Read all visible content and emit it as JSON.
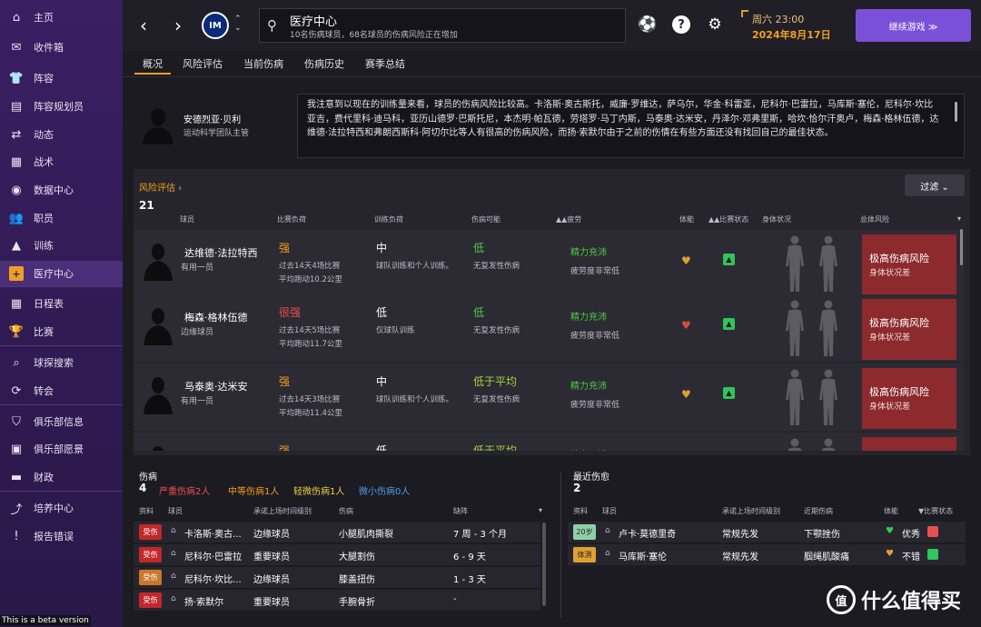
{
  "sidebar": {
    "items": [
      {
        "label": "主页",
        "icon": "home-icon",
        "glyph": "⌂"
      },
      {
        "label": "收件箱",
        "icon": "inbox-icon",
        "glyph": "✉"
      },
      {
        "label": "阵容",
        "icon": "shirt-icon",
        "glyph": "👕"
      },
      {
        "label": "阵容规划员",
        "icon": "clipboard-icon",
        "glyph": "▤"
      },
      {
        "label": "动态",
        "icon": "dynamics-icon",
        "glyph": "⇄"
      },
      {
        "label": "战术",
        "icon": "tactics-icon",
        "glyph": "▦"
      },
      {
        "label": "数据中心",
        "icon": "data-hub-icon",
        "glyph": "◉"
      },
      {
        "label": "职员",
        "icon": "staff-icon",
        "glyph": "👥"
      },
      {
        "label": "训练",
        "icon": "training-icon",
        "glyph": "▲"
      },
      {
        "label": "医疗中心",
        "icon": "medical-icon",
        "glyph": "+"
      },
      {
        "label": "日程表",
        "icon": "calendar-icon",
        "glyph": "▦"
      },
      {
        "label": "比赛",
        "icon": "trophy-icon",
        "glyph": "🏆"
      },
      {
        "label": "球探搜索",
        "icon": "scouting-icon",
        "glyph": "⌕"
      },
      {
        "label": "转会",
        "icon": "transfer-icon",
        "glyph": "⟳"
      },
      {
        "label": "俱乐部信息",
        "icon": "club-info-icon",
        "glyph": "⛉"
      },
      {
        "label": "俱乐部愿景",
        "icon": "club-vision-icon",
        "glyph": "▣"
      },
      {
        "label": "财政",
        "icon": "finance-icon",
        "glyph": "▬"
      },
      {
        "label": "培养中心",
        "icon": "development-icon",
        "glyph": "⤴"
      },
      {
        "label": "报告错误",
        "icon": "report-bug-icon",
        "glyph": "!"
      }
    ]
  },
  "beta_label": "This is a beta version",
  "topbar": {
    "club_initials": "IM",
    "title": "医疗中心",
    "subtitle": "10名伤病球员，68名球员的伤病风险正在增加",
    "weekday_time": "周六 23:00",
    "date": "2024年8月17日",
    "continue_label": "继续游戏 ≫"
  },
  "tabs": [
    "概况",
    "风险评估",
    "当前伤病",
    "伤病历史",
    "赛季总结"
  ],
  "intro": {
    "name": "安德烈亚·贝利",
    "role": "运动科学团队主管",
    "quote": "我注意到以现在的训练量来看，球员的伤病风险比较高。卡洛斯·奥古斯托，威廉·罗维达，萨乌尔，华金·科雷亚，尼科尔·巴雷拉，马库斯·塞伦，尼科尔·坎比亚吉，费代里科·迪马科，亚历山德罗·巴斯托尼，本杰明·帕瓦德，劳塔罗·马丁内斯，马泰奥·达米安，丹泽尔·邓弗里斯，哈坎·恰尔汗奥卢，梅森·格林伍德，达维德·法拉特西和弗朗西斯科·阿切尔比等人有很高的伤病风险，而扬·索默尔由于之前的伤情在有些方面还没有找回自己的最佳状态。"
  },
  "risk": {
    "link": "风险评估 ›",
    "count": "21",
    "filter": "过滤 ⌄",
    "headers": [
      "球员",
      "比赛负荷",
      "训练负荷",
      "伤病可能",
      "▲▲疲劳",
      "体能",
      "▲▲比赛状态",
      "身体状况",
      "总体风险"
    ],
    "rows": [
      {
        "name": "达维德·法拉特西",
        "role": "有用一员",
        "match_level": "强",
        "match_color": "#f0a020",
        "match_sub1": "过去14天4场比赛",
        "match_sub2": "平均跑动10.2公里",
        "train_level": "中",
        "train_sub": "球队训练和个人训练。",
        "inj_level": "低",
        "inj_color": "#4ec945",
        "inj_sub": "无复发性伤病",
        "fitness": "精力充沛",
        "fitness_color": "#4ec945",
        "fatigue": "疲劳度非常低",
        "heart_color": "#e0a030",
        "risk_title": "极高伤病风险",
        "risk_sub": "身体状况差"
      },
      {
        "name": "梅森·格林伍德",
        "role": "边缘球员",
        "match_level": "很强",
        "match_color": "#e85050",
        "match_sub1": "过去14天5场比赛",
        "match_sub2": "平均跑动11.7公里",
        "train_level": "低",
        "train_sub": "仅球队训练",
        "inj_level": "低",
        "inj_color": "#4ec945",
        "inj_sub": "无复发性伤病",
        "fitness": "精力充沛",
        "fitness_color": "#4ec945",
        "fatigue": "疲劳度非常低",
        "heart_color": "#d05040",
        "risk_title": "极高伤病风险",
        "risk_sub": "身体状况差"
      },
      {
        "name": "马泰奥·达米安",
        "role": "有用一员",
        "match_level": "强",
        "match_color": "#f0a020",
        "match_sub1": "过去14天3场比赛",
        "match_sub2": "平均跑动11.4公里",
        "train_level": "中",
        "train_sub": "球队训练和个人训练。",
        "inj_level": "低于平均",
        "inj_color": "#a8d040",
        "inj_sub": "无复发性伤病",
        "fitness": "精力充沛",
        "fitness_color": "#4ec945",
        "fatigue": "疲劳度非常低",
        "heart_color": "#e0a030",
        "risk_title": "极高伤病风险",
        "risk_sub": "身体状况差"
      },
      {
        "name": "",
        "role": "",
        "match_level": "强",
        "match_color": "#f0a020",
        "match_sub1": "",
        "match_sub2": "",
        "train_level": "低",
        "train_sub": "",
        "inj_level": "低于平均",
        "inj_color": "#a8d040",
        "inj_sub": "",
        "fitness": "精力不错",
        "fitness_color": "#4ec945",
        "fatigue": "",
        "heart_color": "#e0a030",
        "risk_title": "",
        "risk_sub": ""
      }
    ]
  },
  "injuries": {
    "title": "伤病",
    "count": "4",
    "severe": "严重伤病2人",
    "moderate": "中等伤病1人",
    "minor": "轻微伤病1人",
    "tiny": "微小伤病0人",
    "headers": [
      "资料",
      "球员",
      "承诺上场时间级别",
      "伤病",
      "缺阵"
    ],
    "rows": [
      {
        "tag": "受伤",
        "tag_color": "#c0282c",
        "player": "卡洛斯·奥古...",
        "level": "边缘球员",
        "injury": "小腿肌肉撕裂",
        "out": "7 周 - 3 个月"
      },
      {
        "tag": "受伤",
        "tag_color": "#c0282c",
        "player": "尼科尔·巴雷拉",
        "level": "重要球员",
        "injury": "大腿割伤",
        "out": "6 - 9 天"
      },
      {
        "tag": "受伤",
        "tag_color": "#c8782c",
        "player": "尼科尔·坎比...",
        "level": "边缘球员",
        "injury": "膝盖扭伤",
        "out": "1 - 3 天"
      },
      {
        "tag": "受伤",
        "tag_color": "#c0282c",
        "player": "扬·索默尔",
        "level": "重要球员",
        "injury": "手腕骨折",
        "out": "-"
      }
    ]
  },
  "recovered": {
    "title": "最近伤愈",
    "count": "2",
    "headers": [
      "资料",
      "球员",
      "承诺上场时间级别",
      "近期伤病",
      "体能",
      "▼比赛状态"
    ],
    "rows": [
      {
        "tag": "20岁",
        "tag_color": "#8fd0a8",
        "player": "卢卡·莫德里奇",
        "level": "常规先发",
        "injury": "下颚挫伤",
        "fitness": "优秀",
        "heart_color": "#3fc84a",
        "status_color": "#e85050"
      },
      {
        "tag": "体测",
        "tag_color": "#e0a030",
        "player": "马库斯·塞伦",
        "level": "常规先发",
        "injury": "腘绳肌酸痛",
        "fitness": "不错",
        "heart_color": "#e0a030",
        "status_color": "#2fc55a"
      }
    ]
  },
  "watermark": "什么值得买"
}
